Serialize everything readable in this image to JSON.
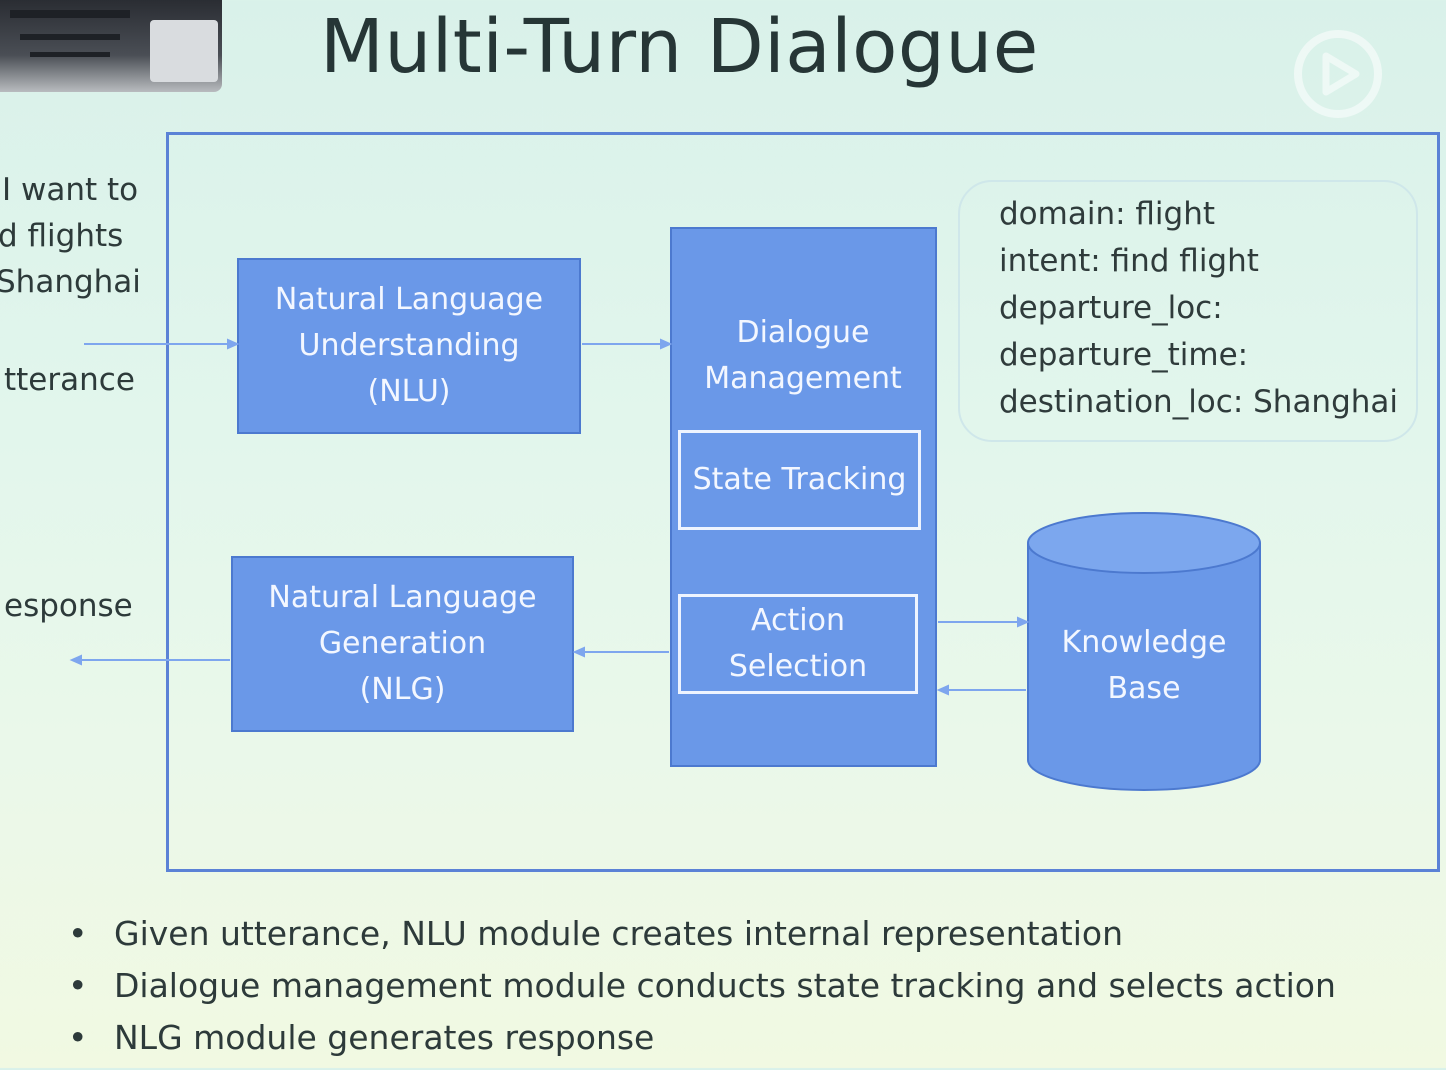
{
  "slide": {
    "title": "Multi-Turn Dialogue"
  },
  "input": {
    "lines": [
      "I want to",
      "d flights",
      "Shanghai"
    ],
    "utterance_label": "tterance",
    "response_label": "esponse"
  },
  "modules": {
    "nlu": "Natural Language\nUnderstanding\n(NLU)",
    "dm": "Dialogue\nManagement",
    "state_tracking": "State Tracking",
    "action_selection": "Action\nSelection",
    "nlg": "Natural Language\nGeneration\n(NLG)",
    "kb": "Knowledge\nBase"
  },
  "state": {
    "lines": [
      "domain: flight",
      "intent: find flight",
      "departure_loc:",
      "departure_time:",
      "destination_loc: Shanghai"
    ]
  },
  "bullets": [
    "Given utterance, NLU module creates internal representation",
    "Dialogue management module conducts state tracking and selects action",
    "NLG module generates response"
  ],
  "colors": {
    "module_fill": "#6a98e8",
    "frame": "#5b82d6",
    "arrow": "#7ea6ee"
  }
}
